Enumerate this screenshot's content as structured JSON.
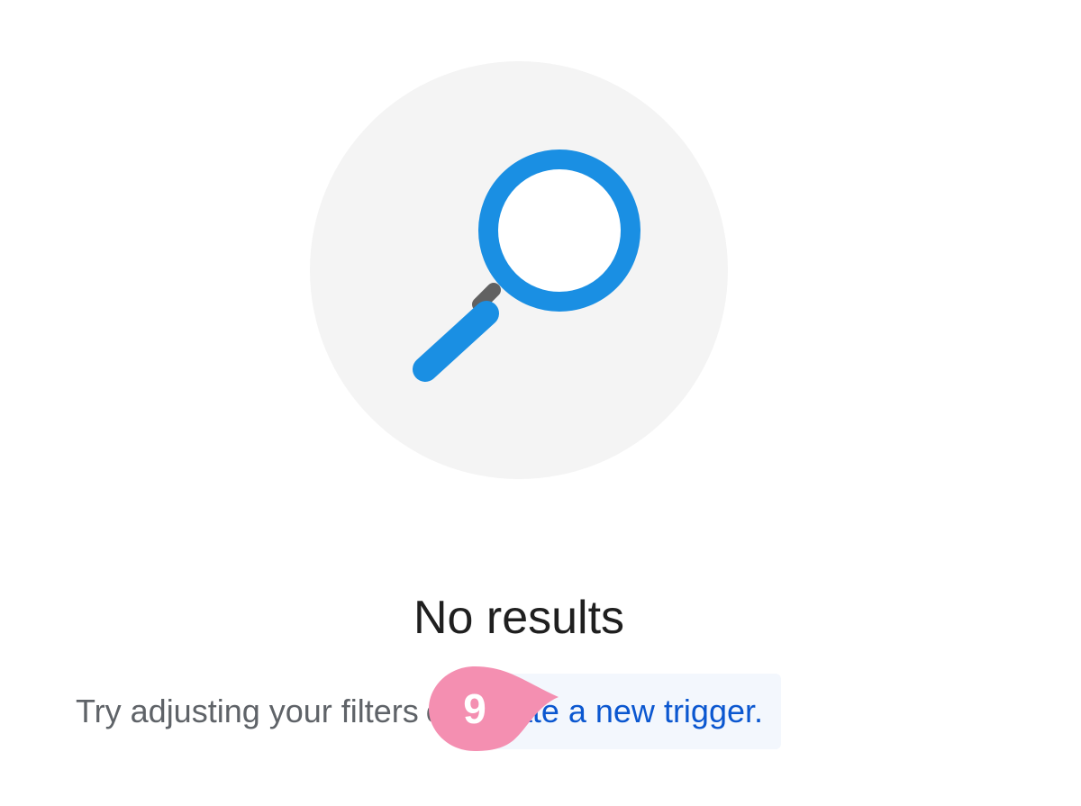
{
  "empty_state": {
    "illustration_icon": "magnifying-glass-icon",
    "title": "No results",
    "message_prefix": "Try adjusting your filters",
    "message_or": "or",
    "link_label": "create a new trigger."
  },
  "step_marker": {
    "label": "9",
    "color": "#f48fb1"
  },
  "colors": {
    "accent": "#0b57d0",
    "icon_blue": "#0b8fe6",
    "illustration_bg": "#f4f4f4"
  }
}
